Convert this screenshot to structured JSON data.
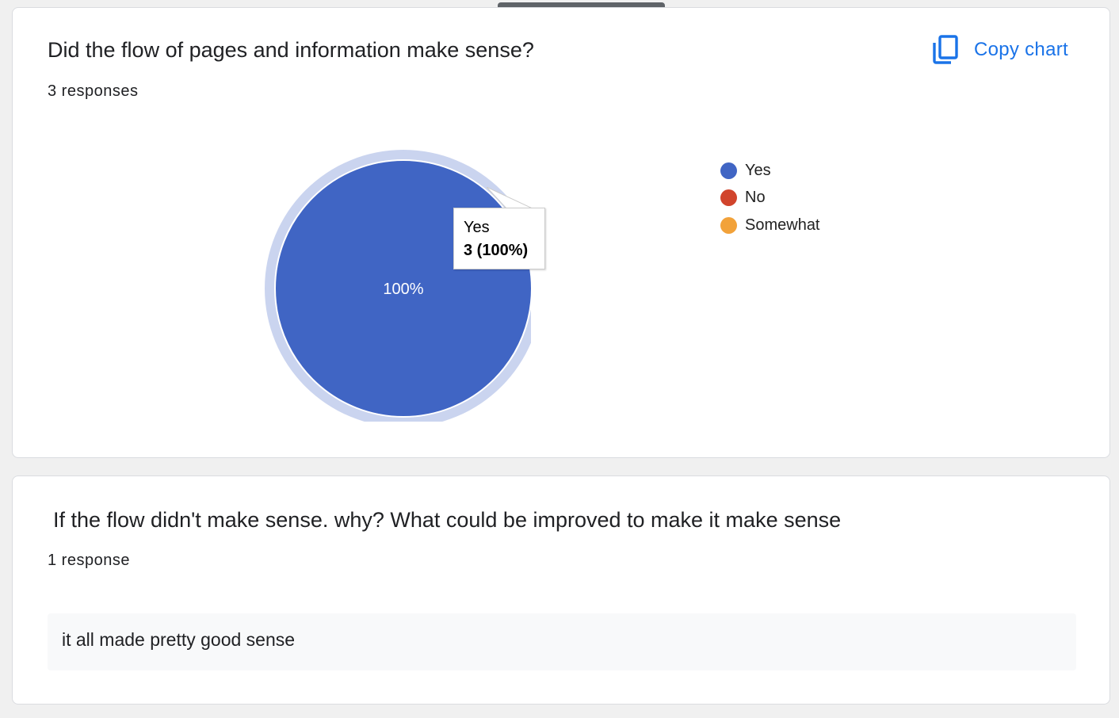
{
  "question1": {
    "title": "Did the flow of pages and information make sense?",
    "response_count": "3 responses",
    "copy_chart_label": "Copy chart",
    "copy_icon": "copy-icon"
  },
  "chart_data": {
    "type": "pie",
    "categories": [
      "Yes",
      "No",
      "Somewhat"
    ],
    "values": [
      3,
      0,
      0
    ],
    "percent_labels": [
      "100%"
    ],
    "colors": [
      "#4065c4",
      "#d1442c",
      "#f2a23a"
    ],
    "legend_position": "right",
    "highlighted_slice": "Yes",
    "tooltip": {
      "label": "Yes",
      "value": "3 (100%)"
    }
  },
  "question2": {
    "title": "If the flow didn't make sense. why? What could be improved to make it make sense",
    "response_count": "1 response",
    "responses": [
      "it all made pretty good sense"
    ]
  },
  "colors": {
    "accent": "#1a73e8",
    "page_background": "#f0f0f0",
    "card_background": "#ffffff",
    "answer_background": "#f8f9fa"
  }
}
